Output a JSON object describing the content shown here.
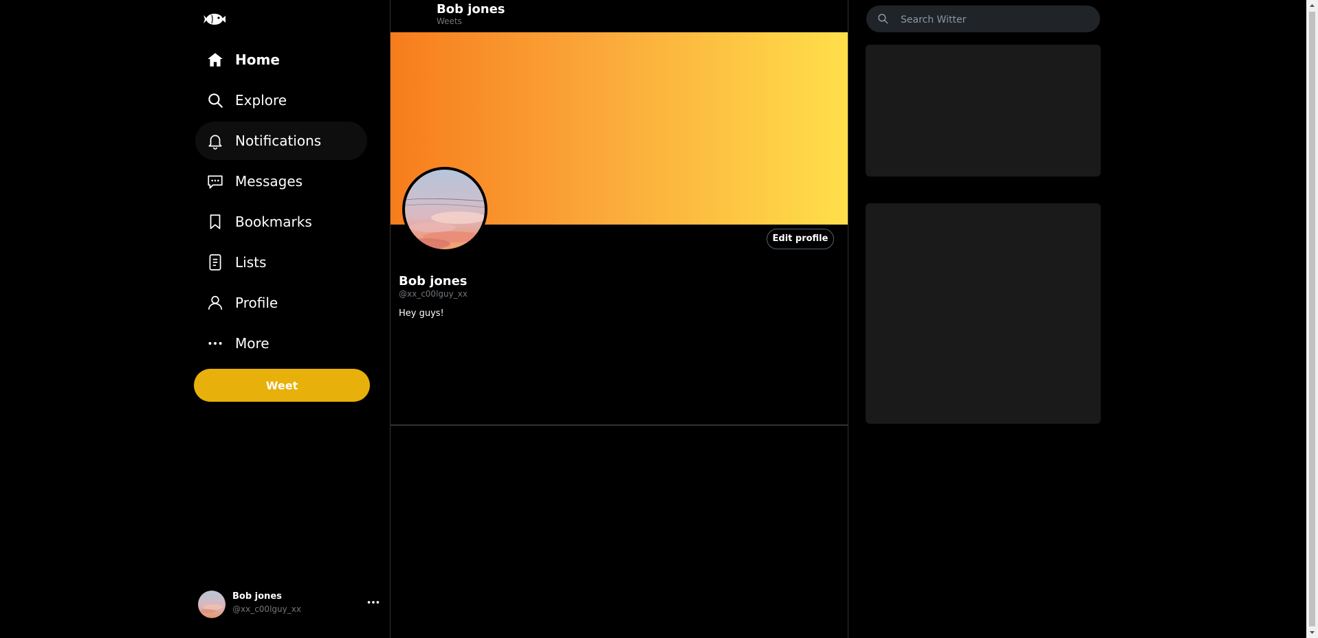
{
  "sidebar": {
    "logo_icon": "fish-logo-icon",
    "items": [
      {
        "label": "Home",
        "icon": "home-icon",
        "active": false,
        "bold": true
      },
      {
        "label": "Explore",
        "icon": "search-icon",
        "active": false
      },
      {
        "label": "Notifications",
        "icon": "bell-icon",
        "active": true
      },
      {
        "label": "Messages",
        "icon": "message-icon",
        "active": false
      },
      {
        "label": "Bookmarks",
        "icon": "bookmark-icon",
        "active": false
      },
      {
        "label": "Lists",
        "icon": "list-icon",
        "active": false
      },
      {
        "label": "Profile",
        "icon": "user-icon",
        "active": false
      },
      {
        "label": "More",
        "icon": "more-dots-icon",
        "active": false
      }
    ],
    "weet_button": "Weet",
    "account": {
      "name": "Bob jones",
      "handle": "@xx_c00lguy_xx"
    }
  },
  "main": {
    "header": {
      "name": "Bob jones",
      "subtitle": "Weets"
    },
    "profile": {
      "edit_button": "Edit profile",
      "name": "Bob jones",
      "handle": "@xx_c00lguy_xx",
      "bio": "Hey guys!"
    }
  },
  "right": {
    "search": {
      "placeholder": "Search Witter"
    }
  },
  "colors": {
    "accent": "#e8b00a",
    "banner_start": "#f77c1c",
    "banner_end": "#ffdf4a",
    "background": "#000000",
    "card": "#1a1a1a"
  }
}
